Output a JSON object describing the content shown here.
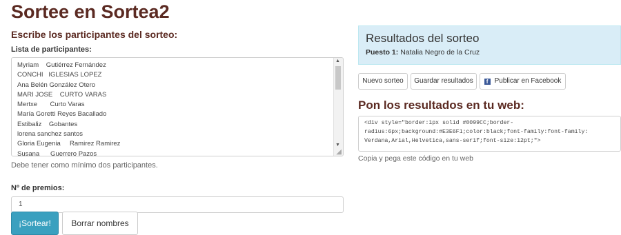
{
  "page": {
    "title": "Sortee en Sortea2"
  },
  "form": {
    "heading": "Escribe los participantes del sorteo:",
    "list_label": "Lista de participantes:",
    "participants": [
      "Myriam    Gutiérrez Fernández",
      "CONCHI   IGLESIAS LOPEZ",
      "Ana Belén González Otero",
      "MARI JOSE    CURTO VARAS",
      "Mertxe       Curto Varas",
      "María Goretti Reyes Bacallado",
      "Estibaliz    Gobantes",
      "lorena sanchez santos",
      "Gloria Eugenia     Ramirez Ramirez",
      "Susana      Guerrero Pazos"
    ],
    "list_help": "Debe tener como mínimo dos participantes.",
    "prizes_label": "Nº de premios:",
    "prizes_value": "1",
    "draw_button": "¡Sortear!",
    "clear_button": "Borrar nombres"
  },
  "results": {
    "title": "Resultados del sorteo",
    "prize_label": "Puesto 1:",
    "winner": "Natalia Negro de la Cruz"
  },
  "actions": {
    "new_draw": "Nuevo sorteo",
    "save_results": "Guardar resultados",
    "publish_facebook": "Publicar en Facebook"
  },
  "embed": {
    "heading": "Pon los resultados en tu web:",
    "code_lines": [
      "<div style=\"border:1px solid #0099CC;border-",
      "radius:6px;background:#E3E6F1;color:black;font-family:font-family:",
      "Verdana,Arial,Helvetica,sans-serif;font-size:12pt;\">"
    ],
    "help": "Copia y pega este código en tu web"
  },
  "colors": {
    "title": "#5b2a22",
    "primary_button": "#3aa0bf",
    "results_bg": "#d9edf7",
    "facebook": "#3b5998"
  },
  "icons": {
    "facebook": "facebook-icon",
    "scroll_up": "scroll-up-arrow-icon",
    "scroll_down": "scroll-down-arrow-icon",
    "resize": "resize-grip-icon"
  }
}
